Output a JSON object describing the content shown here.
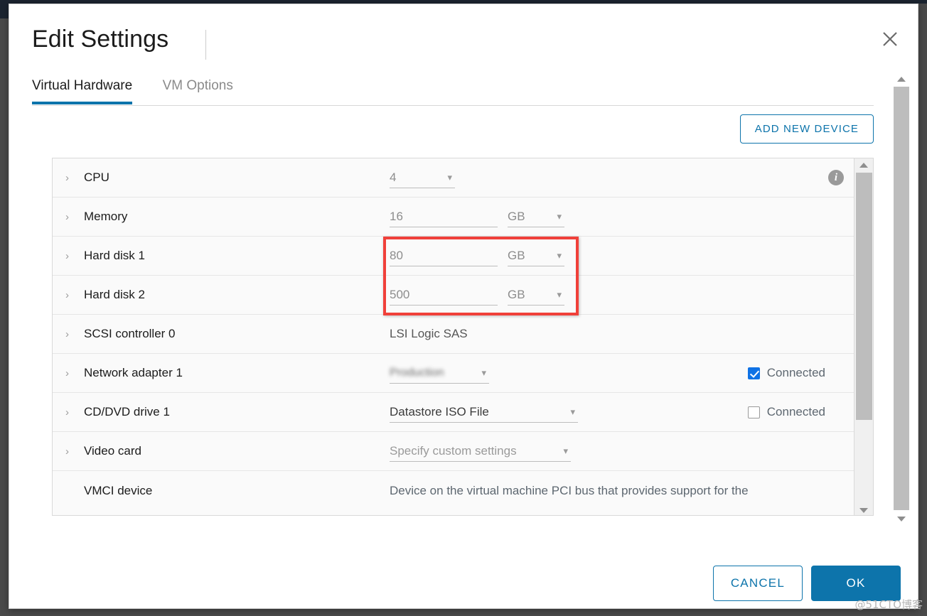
{
  "dialog": {
    "title": "Edit Settings",
    "close_icon": "close-icon"
  },
  "tabs": [
    {
      "label": "Virtual Hardware",
      "active": true
    },
    {
      "label": "VM Options",
      "active": false
    }
  ],
  "toolbar": {
    "add_new_device_label": "ADD NEW DEVICE"
  },
  "devices": [
    {
      "name": "CPU",
      "value": "4",
      "unit": null,
      "has_info": true
    },
    {
      "name": "Memory",
      "value": "16",
      "unit": "GB",
      "has_info": false
    },
    {
      "name": "Hard disk 1",
      "value": "80",
      "unit": "GB",
      "has_info": false
    },
    {
      "name": "Hard disk 2",
      "value": "500",
      "unit": "GB",
      "has_info": false
    },
    {
      "name": "SCSI controller 0",
      "value": "LSI Logic SAS",
      "unit": null,
      "has_info": false
    },
    {
      "name": "Network adapter 1",
      "value": "",
      "unit": null,
      "connected_label": "Connected",
      "connected": true,
      "has_info": false
    },
    {
      "name": "CD/DVD drive 1",
      "value": "Datastore ISO File",
      "unit": null,
      "connected_label": "Connected",
      "connected": false,
      "has_info": false
    },
    {
      "name": "Video card",
      "value": "Specify custom settings",
      "unit": null,
      "has_info": false
    },
    {
      "name": "VMCI device",
      "value": "Device on the virtual machine PCI bus that provides support for the",
      "unit": null,
      "has_info": false
    }
  ],
  "footer": {
    "cancel_label": "CANCEL",
    "ok_label": "OK"
  },
  "watermark": "@51CTO博客",
  "colors": {
    "accent": "#0d74ab",
    "tab_underline": "#0d74ab",
    "checkbox_checked": "#0f72e5",
    "highlight_box": "#f0403a",
    "row_background": "#fafafa"
  }
}
